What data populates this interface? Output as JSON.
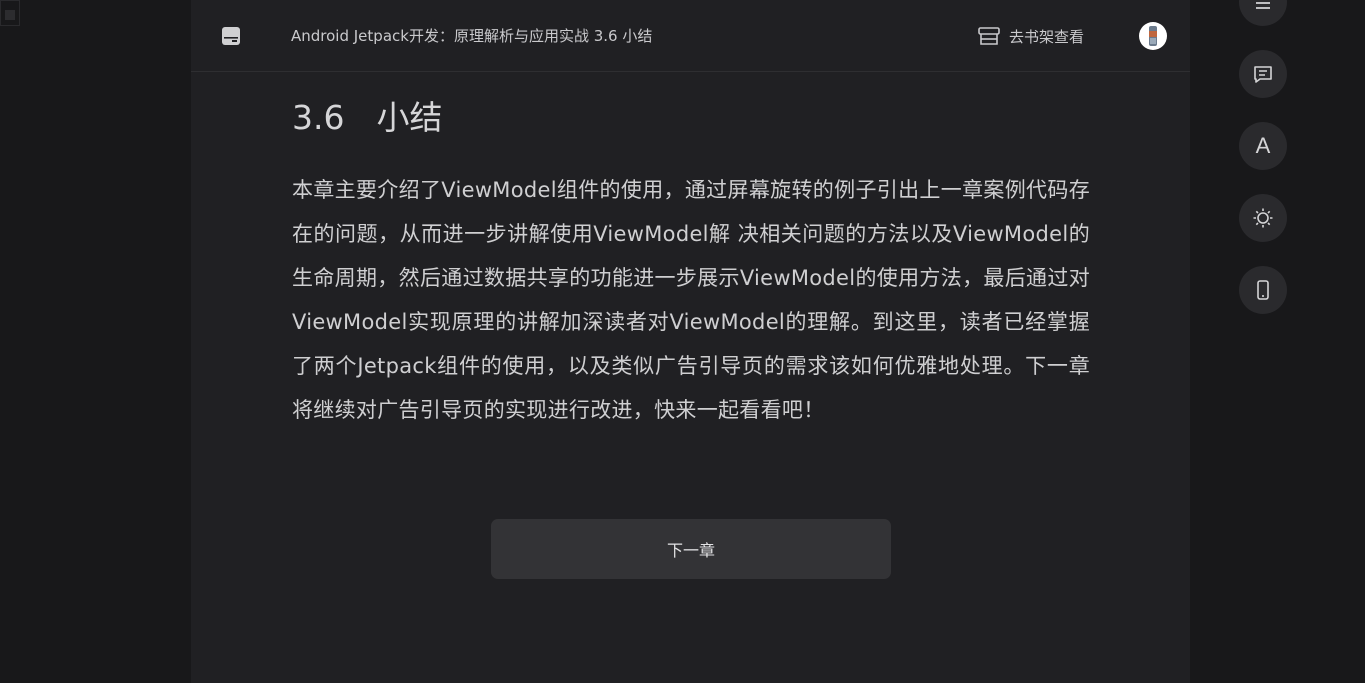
{
  "header": {
    "book_title": "Android Jetpack开发：原理解析与应用实战 3.6 小结",
    "shelf_label": "去书架查看"
  },
  "chapter": {
    "number": "3.6",
    "title": "小结",
    "paragraph": "本章主要介绍了ViewModel组件的使用，通过屏幕旋转的例子引出上一章案例代码存在的问题，从而进一步讲解使用ViewModel解 决相关问题的方法以及ViewModel的生命周期，然后通过数据共享的功能进一步展示ViewModel的使用方法，最后通过对ViewModel实现原理的讲解加深读者对ViewModel的理解。到这里，读者已经掌握了两个Jetpack组件的使用，以及类似广告引导页的需求该如何优雅地处理。下一章将继续对广告引导页的实现进行改进，快来一起看看吧！"
  },
  "next_chapter_label": "下一章",
  "sidebar": {
    "font_button_letter": "A",
    "icons": [
      "menu-icon",
      "comment-icon",
      "font-icon",
      "brightness-icon",
      "phone-icon"
    ]
  },
  "colors": {
    "page_bg": "#18181a",
    "reader_bg": "#202023",
    "button_bg": "#333336",
    "side_button_bg": "#2a2a2d",
    "text": "#cfcfd1"
  }
}
